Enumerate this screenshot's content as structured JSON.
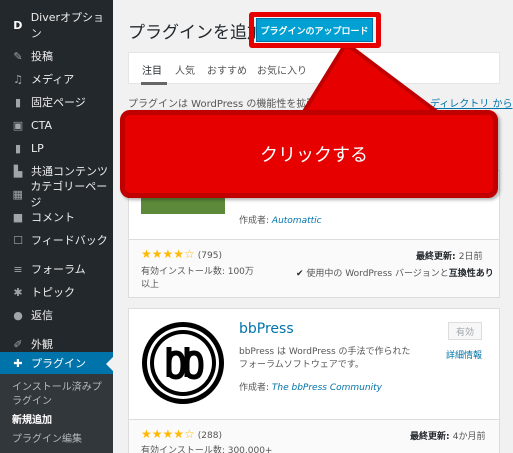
{
  "sidebar": {
    "items": [
      {
        "icon": "diver-logo-icon",
        "label": "Diverオプション"
      },
      {
        "icon": "pushpin-icon",
        "label": "投稿"
      },
      {
        "icon": "media-icon",
        "label": "メディア"
      },
      {
        "icon": "page-icon",
        "label": "固定ページ"
      },
      {
        "icon": "cta-icon",
        "label": "CTA"
      },
      {
        "icon": "lp-icon",
        "label": "LP"
      },
      {
        "icon": "shared-content-icon",
        "label": "共通コンテンツ"
      },
      {
        "icon": "category-page-icon",
        "label": "カテゴリーページ"
      },
      {
        "icon": "comment-icon",
        "label": "コメント"
      },
      {
        "icon": "feedback-icon",
        "label": "フィードバック"
      },
      {
        "icon": "forum-icon",
        "label": "フォーラム"
      },
      {
        "icon": "topic-icon",
        "label": "トピック"
      },
      {
        "icon": "reply-icon",
        "label": "返信"
      },
      {
        "icon": "appearance-icon",
        "label": "外観"
      },
      {
        "icon": "plugin-icon",
        "label": "プラグイン"
      }
    ],
    "submenu": [
      {
        "label": "インストール済みプラグイン"
      },
      {
        "label": "新規追加"
      },
      {
        "label": "プラグイン編集"
      }
    ]
  },
  "header": {
    "title": "プラグインを追加",
    "upload_button": "プラグインのアップロード"
  },
  "tabs": [
    {
      "label": "注目"
    },
    {
      "label": "人気"
    },
    {
      "label": "おすすめ"
    },
    {
      "label": "お気に入り"
    }
  ],
  "description": "プラグインは WordPress の機能性を拡張するものです。",
  "directory_link": "ディレクトリ から",
  "callout": {
    "text": "クリックする"
  },
  "plugin_cards": [
    {
      "name": "",
      "author_label": "作成者: ",
      "author": "Automattic",
      "rating_count": "(795)",
      "installs": "有効インストール数: 100万以上",
      "last_updated_label": "最終更新: ",
      "last_updated": "2日前",
      "compat_check": "✔",
      "compat_prefix": " 使用中の WordPress バージョンと",
      "compat_bold": "互換性あり"
    },
    {
      "name": "bbPress",
      "active_label": "有効",
      "details_link": "詳細情報",
      "description_lines": [
        "bbPress は WordPress の手法で作られた",
        "フォーラムソフトウェアです。"
      ],
      "author_label": "作成者: ",
      "author": "The bbPress Community",
      "rating_count": "(288)",
      "installs": "有効インストール数: 300,000+",
      "last_updated_label": "最終更新: ",
      "last_updated": "4か月前"
    }
  ],
  "colors": {
    "sidebar_bg": "#23282d",
    "active_blue": "#0073aa",
    "button_blue": "#00a0d2",
    "callout_red": "#e60000",
    "star_gold": "#ffb900"
  }
}
